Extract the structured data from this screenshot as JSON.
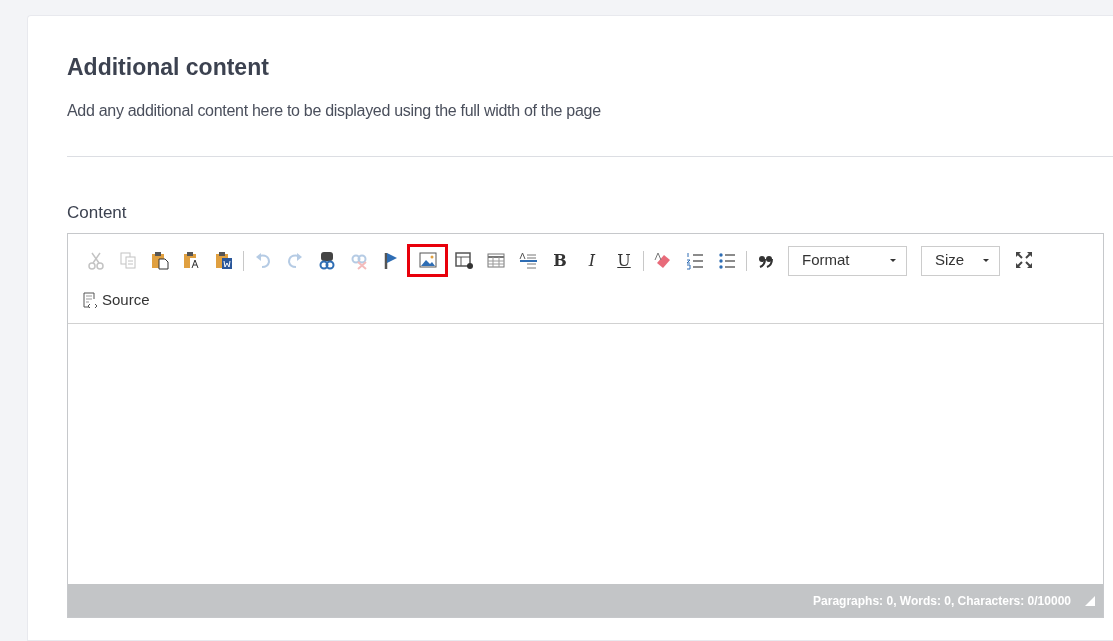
{
  "section": {
    "title": "Additional content",
    "description": "Add any additional content here to be displayed using the full width of the page"
  },
  "field": {
    "label": "Content"
  },
  "toolbar": [
    {
      "kind": "cut",
      "disabled": true,
      "highlighted": false
    },
    {
      "kind": "copy",
      "disabled": true,
      "highlighted": false
    },
    {
      "kind": "paste",
      "disabled": false,
      "highlighted": false
    },
    {
      "kind": "pastetext",
      "disabled": false,
      "highlighted": false
    },
    {
      "kind": "pasteword",
      "disabled": false,
      "highlighted": false
    },
    {
      "kind": "separator"
    },
    {
      "kind": "undo",
      "disabled": true,
      "highlighted": false
    },
    {
      "kind": "redo",
      "disabled": true,
      "highlighted": false
    },
    {
      "kind": "link",
      "disabled": false,
      "highlighted": false
    },
    {
      "kind": "unlink",
      "disabled": true,
      "highlighted": false
    },
    {
      "kind": "anchor",
      "disabled": false,
      "highlighted": false
    },
    {
      "kind": "image",
      "disabled": false,
      "highlighted": true
    },
    {
      "kind": "template",
      "disabled": false,
      "highlighted": false
    },
    {
      "kind": "table",
      "disabled": false,
      "highlighted": false
    },
    {
      "kind": "rule",
      "disabled": false,
      "highlighted": false
    },
    {
      "kind": "bold",
      "label": "B",
      "disabled": false,
      "highlighted": false
    },
    {
      "kind": "italic",
      "label": "I",
      "disabled": false,
      "highlighted": false
    },
    {
      "kind": "underline",
      "label": "U",
      "disabled": false,
      "highlighted": false
    },
    {
      "kind": "separator"
    },
    {
      "kind": "eraser",
      "disabled": false,
      "highlighted": false
    },
    {
      "kind": "numbered",
      "disabled": false,
      "highlighted": false
    },
    {
      "kind": "bulleted",
      "disabled": false,
      "highlighted": false
    },
    {
      "kind": "separator"
    },
    {
      "kind": "quote",
      "disabled": false,
      "highlighted": false
    },
    {
      "kind": "dropdown",
      "label": "Format"
    },
    {
      "kind": "dropdown",
      "label": "Size"
    },
    {
      "kind": "maximize",
      "disabled": false,
      "highlighted": false
    },
    {
      "kind": "source",
      "label": "Source",
      "disabled": false,
      "highlighted": false
    }
  ],
  "status_bar": "Paragraphs: 0, Words: 0, Characters: 0/10000"
}
